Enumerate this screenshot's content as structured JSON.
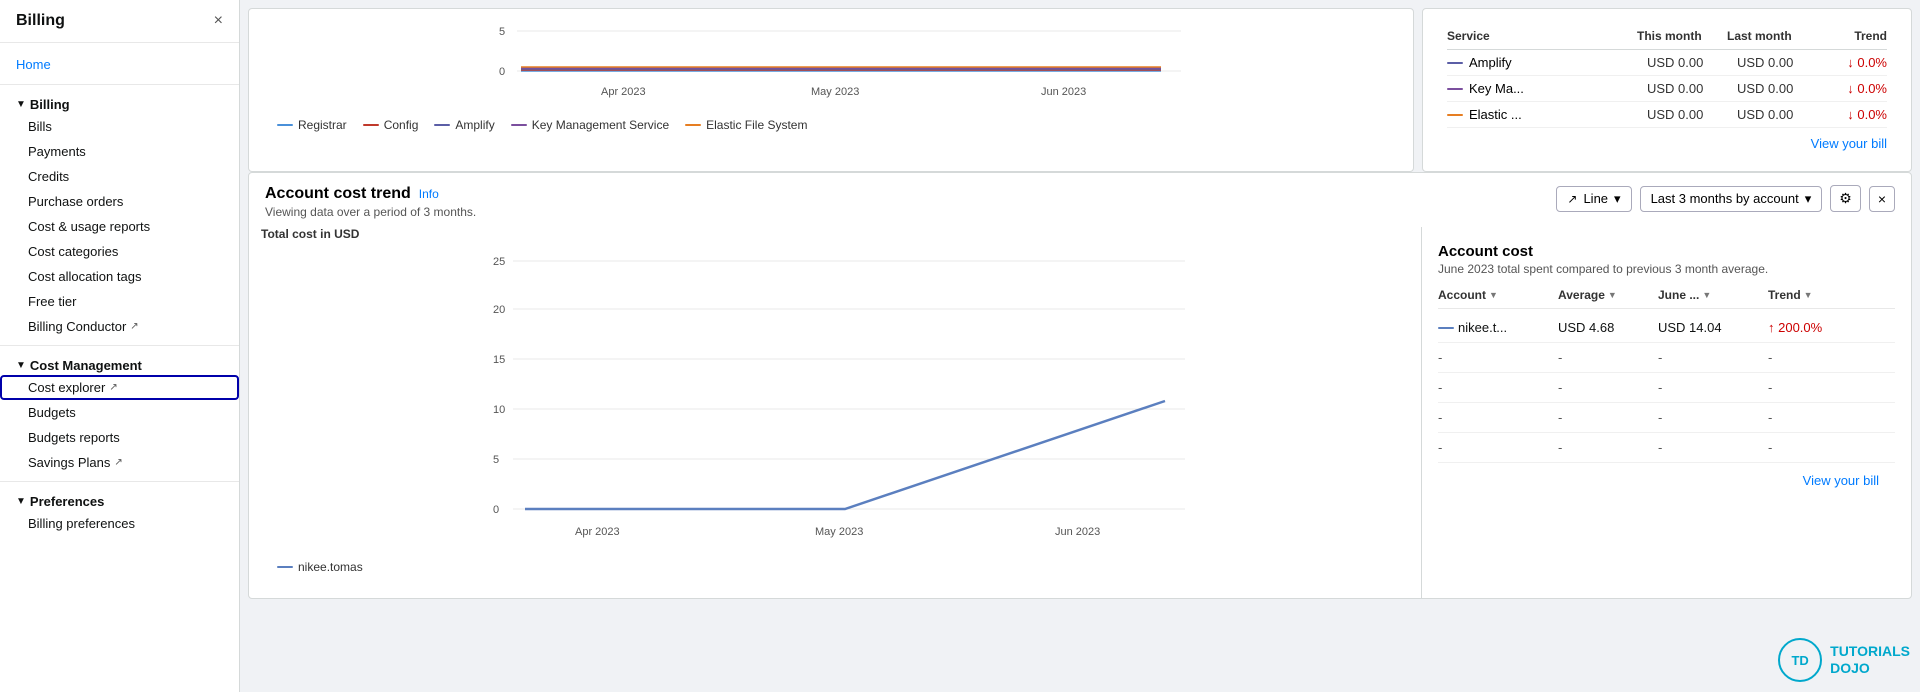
{
  "sidebar": {
    "title": "Billing",
    "close_label": "×",
    "home_label": "Home",
    "sections": [
      {
        "label": "Billing",
        "items": [
          {
            "label": "Bills",
            "ext": false,
            "active": false,
            "highlighted": false
          },
          {
            "label": "Payments",
            "ext": false,
            "active": false,
            "highlighted": false
          },
          {
            "label": "Credits",
            "ext": false,
            "active": false,
            "highlighted": false
          },
          {
            "label": "Purchase orders",
            "ext": false,
            "active": false,
            "highlighted": false
          },
          {
            "label": "Cost & usage reports",
            "ext": false,
            "active": false,
            "highlighted": false
          },
          {
            "label": "Cost categories",
            "ext": false,
            "active": false,
            "highlighted": false
          },
          {
            "label": "Cost allocation tags",
            "ext": false,
            "active": false,
            "highlighted": false
          },
          {
            "label": "Free tier",
            "ext": false,
            "active": false,
            "highlighted": false
          },
          {
            "label": "Billing Conductor",
            "ext": true,
            "active": false,
            "highlighted": false
          }
        ]
      },
      {
        "label": "Cost Management",
        "items": [
          {
            "label": "Cost explorer",
            "ext": true,
            "active": false,
            "highlighted": true
          },
          {
            "label": "Budgets",
            "ext": false,
            "active": false,
            "highlighted": false
          },
          {
            "label": "Budgets reports",
            "ext": false,
            "active": false,
            "highlighted": false
          },
          {
            "label": "Savings Plans",
            "ext": true,
            "active": false,
            "highlighted": false
          }
        ]
      },
      {
        "label": "Preferences",
        "items": [
          {
            "label": "Billing preferences",
            "ext": false,
            "active": false,
            "highlighted": false
          }
        ]
      }
    ]
  },
  "top_chart": {
    "y_labels": [
      "5",
      "0"
    ],
    "x_labels": [
      "Apr 2023",
      "May 2023",
      "Jun 2023"
    ],
    "legend": [
      {
        "label": "Registrar",
        "color": "#4a90d9"
      },
      {
        "label": "Config",
        "color": "#c0392b"
      },
      {
        "label": "Amplify",
        "color": "#5b5ea6"
      },
      {
        "label": "Key Management Service",
        "color": "#7b4f9e"
      },
      {
        "label": "Elastic File System",
        "color": "#e67e22"
      }
    ]
  },
  "top_right_table": {
    "rows": [
      {
        "service": "Amplify",
        "color": "#5b5ea6",
        "current": "USD 0.00",
        "previous": "USD 0.00",
        "trend": "↓ 0.0%"
      },
      {
        "service": "Key Ma...",
        "color": "#7b4f9e",
        "current": "USD 0.00",
        "previous": "USD 0.00",
        "trend": "↓ 0.0%"
      },
      {
        "service": "Elastic ...",
        "color": "#e67e22",
        "current": "USD 0.00",
        "previous": "USD 0.00",
        "trend": "↓ 0.0%"
      }
    ],
    "view_bill_label": "View your bill"
  },
  "trend_section": {
    "title": "Account cost trend",
    "info_label": "Info",
    "subtitle": "Viewing data over a period of 3 months.",
    "line_dropdown_label": "Line",
    "period_dropdown_label": "Last 3 months by account",
    "chart_label": "Total cost in USD",
    "y_labels": [
      "25",
      "20",
      "15",
      "10",
      "5",
      "0"
    ],
    "x_labels": [
      "Apr 2023",
      "May 2023",
      "Jun 2023"
    ],
    "legend_label": "nikee.tomas",
    "account_cost": {
      "title": "Account cost",
      "subtitle": "June 2023 total spent compared to previous 3 month average.",
      "columns": {
        "account": "Account",
        "average": "Average",
        "june": "June ...",
        "trend": "Trend"
      },
      "rows": [
        {
          "account": "— nikee.t...",
          "color": "#5b5ea6",
          "average": "USD 4.68",
          "june": "USD 14.04",
          "trend": "↑ 200.0%",
          "trend_up": true
        },
        {
          "account": "-",
          "color": null,
          "average": "-",
          "june": "-",
          "trend": "-",
          "trend_up": false
        },
        {
          "account": "-",
          "color": null,
          "average": "-",
          "june": "-",
          "trend": "-",
          "trend_up": false
        },
        {
          "account": "-",
          "color": null,
          "average": "-",
          "june": "-",
          "trend": "-",
          "trend_up": false
        },
        {
          "account": "-",
          "color": null,
          "average": "-",
          "june": "-",
          "trend": "-",
          "trend_up": false
        }
      ],
      "view_bill_label": "View your bill"
    }
  }
}
